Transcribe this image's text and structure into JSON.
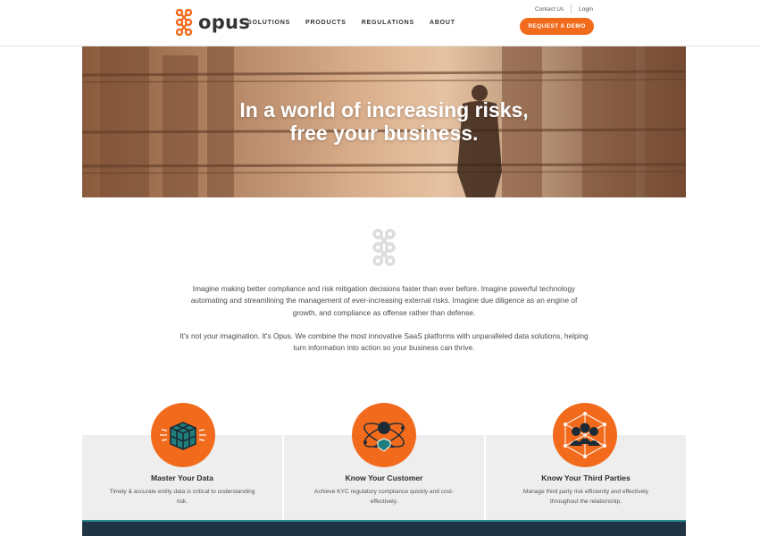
{
  "brand": {
    "name": "opus",
    "accent": "#f26b1d",
    "dark": "#1f3545"
  },
  "nav": {
    "items": [
      "SOLUTIONS",
      "PRODUCTS",
      "REGULATIONS",
      "ABOUT"
    ]
  },
  "utility": {
    "contact": "Contact Us",
    "login": "Login"
  },
  "cta": {
    "label": "REQUEST A DEMO"
  },
  "hero": {
    "line1": "In a world of increasing risks,",
    "line2": "free your business."
  },
  "intro": {
    "p1": "Imagine making better compliance and risk mitigation decisions faster than ever before. Imagine powerful technology automating and streamlining the management of ever-increasing external risks. Imagine due diligence as an engine of growth, and compliance as offense rather than defense.",
    "p2": "It's not your imagination. It's Opus. We combine the most innovative SaaS platforms with unparalleled data solutions, helping turn information into action so your business can thrive."
  },
  "features": [
    {
      "title": "Master Your Data",
      "desc": "Timely & accurate entity data is critical to understanding risk.",
      "icon": "data-cube-icon"
    },
    {
      "title": "Know Your Customer",
      "desc": "Achieve KYC regulatory compliance quickly and cost-effectively.",
      "icon": "customer-shield-icon"
    },
    {
      "title": "Know Your Third Parties",
      "desc": "Manage third party risk efficiently and effectively throughout the relationship.",
      "icon": "third-parties-network-icon"
    }
  ]
}
